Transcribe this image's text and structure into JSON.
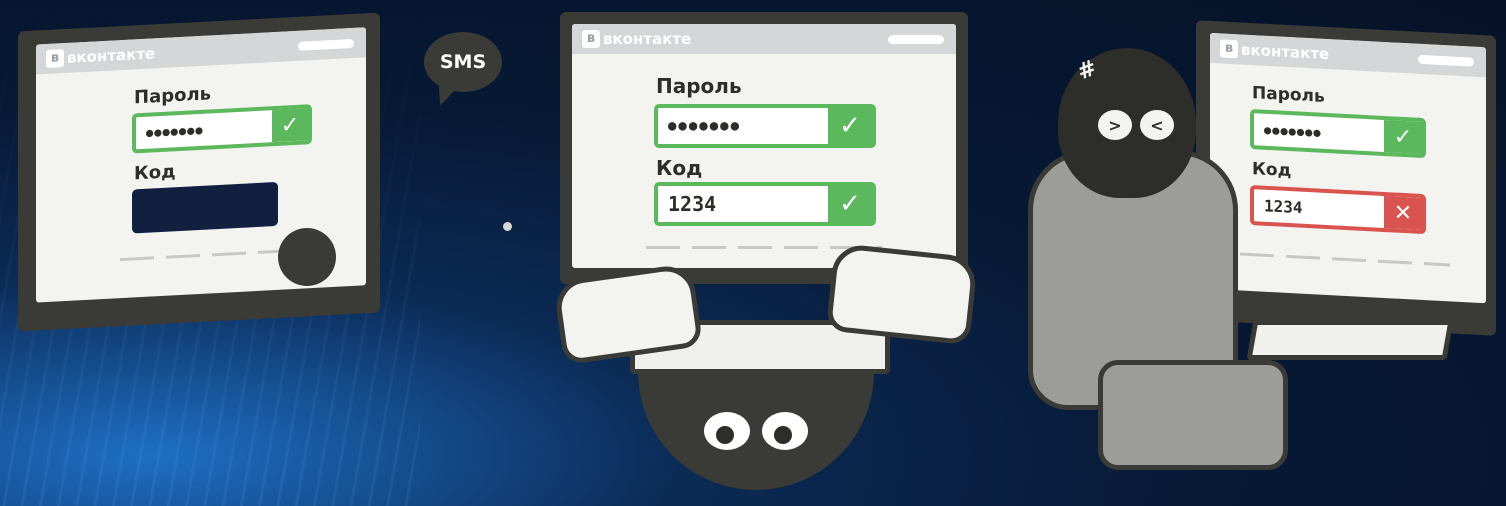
{
  "panels": {
    "left": {
      "brand": "вконтакте",
      "password_label": "Пароль",
      "password_value": "●●●●●●●",
      "code_label": "Код",
      "check": "✓"
    },
    "center": {
      "brand": "вконтакте",
      "password_label": "Пароль",
      "password_value": "●●●●●●●",
      "code_label": "Код",
      "code_value": "1234",
      "check": "✓"
    },
    "right": {
      "brand": "вконтакте",
      "password_label": "Пароль",
      "password_value": "●●●●●●●",
      "code_label": "Код",
      "code_value": "1234",
      "check": "✓",
      "error": "✕"
    }
  },
  "sms_bubble": "SMS",
  "colors": {
    "success": "#5cb85c",
    "error": "#d9534f",
    "outline": "#3a3a36",
    "background": "#061228"
  }
}
